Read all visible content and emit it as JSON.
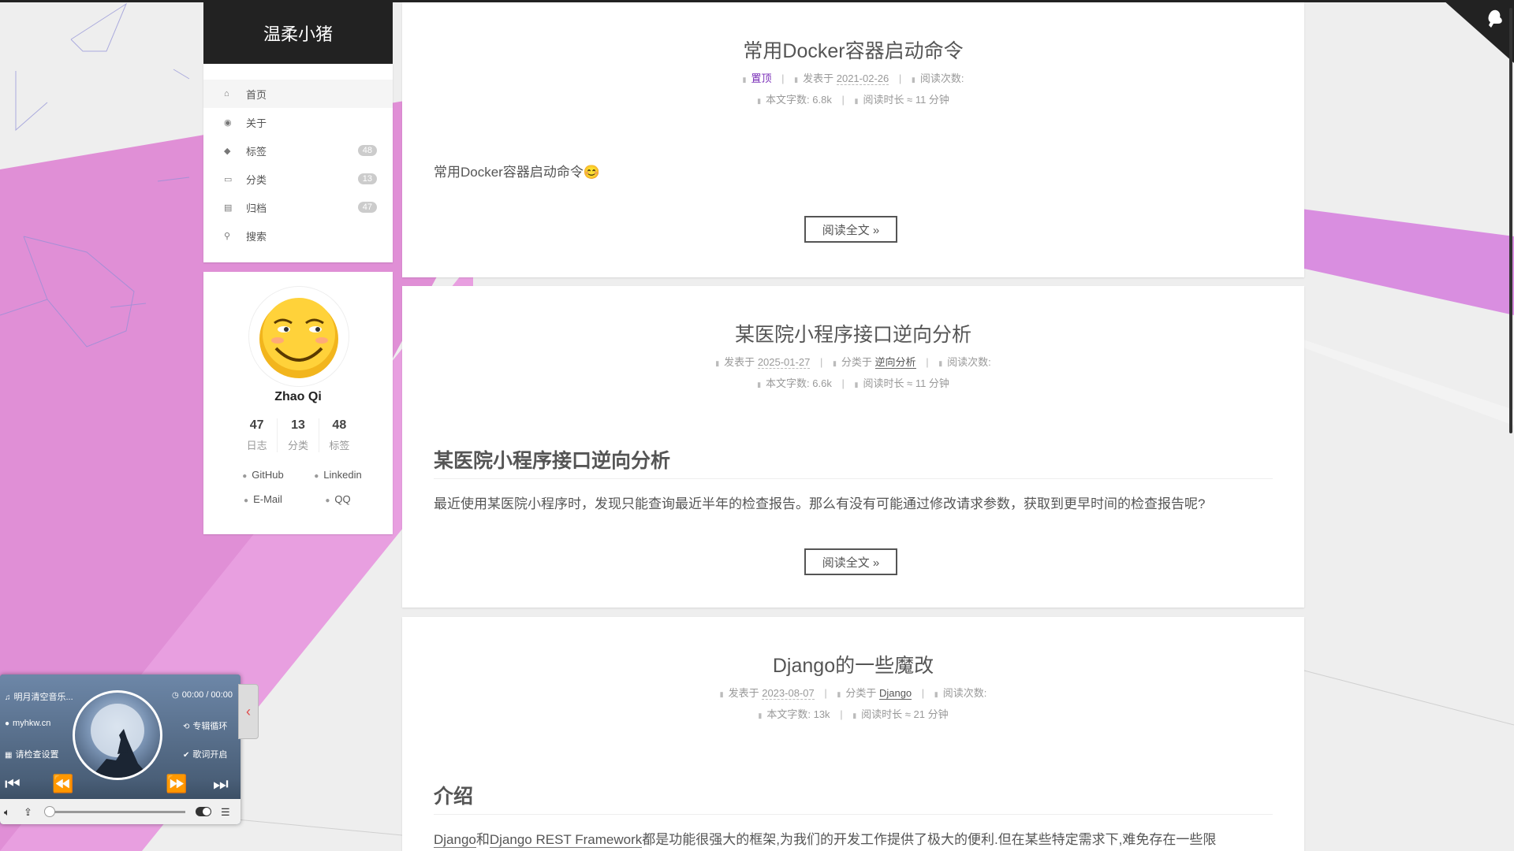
{
  "site": {
    "title": "温柔小猪"
  },
  "menu": [
    {
      "icon": "home-icon",
      "label": "首页",
      "badge": ""
    },
    {
      "icon": "user-icon",
      "label": "关于",
      "badge": ""
    },
    {
      "icon": "tags-icon",
      "label": "标签",
      "badge": "48"
    },
    {
      "icon": "folder-icon",
      "label": "分类",
      "badge": "13"
    },
    {
      "icon": "archive-icon",
      "label": "归档",
      "badge": "47"
    },
    {
      "icon": "search-icon",
      "label": "搜索",
      "badge": ""
    }
  ],
  "author": {
    "name": "Zhao Qi",
    "stats": [
      {
        "num": "47",
        "label": "日志"
      },
      {
        "num": "13",
        "label": "分类"
      },
      {
        "num": "48",
        "label": "标签"
      }
    ],
    "links": [
      "GitHub",
      "Linkedin",
      "E-Mail",
      "QQ"
    ]
  },
  "posts": [
    {
      "title": "常用Docker容器启动命令",
      "pinned": "置顶",
      "posted_label": "发表于",
      "date": "2021-02-26",
      "views_label": "阅读次数:",
      "words_label": "本文字数:",
      "words": "6.8k",
      "time_label": "阅读时长 ≈",
      "time": "11 分钟",
      "excerpt": "常用Docker容器启动命令😊",
      "read_more": "阅读全文 »"
    },
    {
      "title": "某医院小程序接口逆向分析",
      "posted_label": "发表于",
      "date": "2025-01-27",
      "category_label": "分类于",
      "category": "逆向分析",
      "views_label": "阅读次数:",
      "words_label": "本文字数:",
      "words": "6.6k",
      "time_label": "阅读时长 ≈",
      "time": "11 分钟",
      "heading": "某医院小程序接口逆向分析",
      "excerpt": "最近使用某医院小程序时，发现只能查询最近半年的检查报告。那么有没有可能通过修改请求参数，获取到更早时间的检查报告呢?",
      "read_more": "阅读全文 »"
    },
    {
      "title": "Django的一些魔改",
      "posted_label": "发表于",
      "date": "2023-08-07",
      "category_label": "分类于",
      "category": "Django",
      "views_label": "阅读次数:",
      "words_label": "本文字数:",
      "words": "13k",
      "time_label": "阅读时长 ≈",
      "time": "21 分钟",
      "heading": "介绍",
      "excerpt_link1": "Django",
      "excerpt_and": "和",
      "excerpt_link2": "Django REST Framework",
      "excerpt_rest": "都是功能很强大的框架,为我们的开发工作提供了极大的便利.但在某些特定需求下,难免存在一些限"
    }
  ],
  "player": {
    "song": "明月清空音乐...",
    "site": "myhkw.cn",
    "notice": "请检查设置",
    "time": "00:00 / 00:00",
    "loop": "专辑循环",
    "lyrics": "歌词开启",
    "progress": 0
  },
  "colors": {
    "accent_pink": "#d98fd4",
    "brand_bg": "#222222",
    "pinned": "#7a2fb8"
  }
}
